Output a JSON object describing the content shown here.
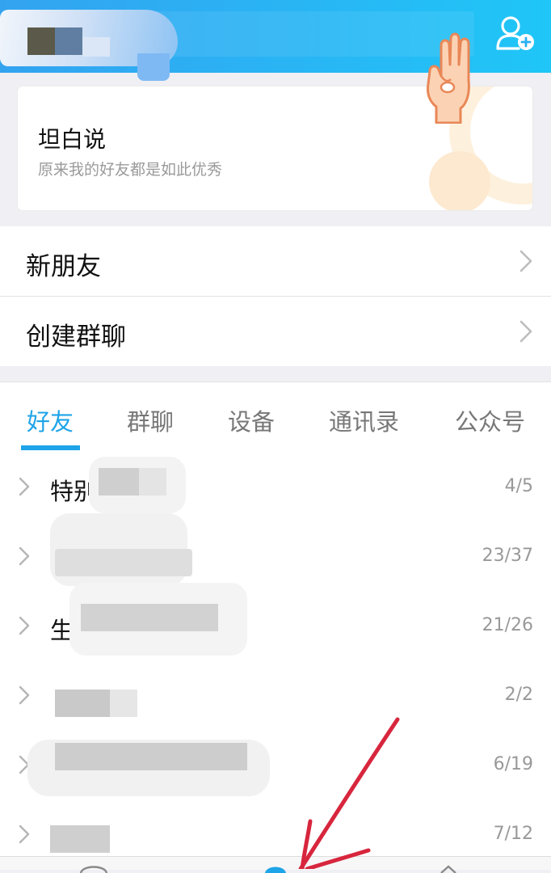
{
  "header": {
    "bg_color": "#2aaef3",
    "icons": [
      "user-avatar-blurred",
      "add-contact-icon"
    ]
  },
  "card": {
    "title": "坦白说",
    "subtitle": "原来我的好友都是如此优秀",
    "icon": "hand-three-fingers"
  },
  "menu": {
    "items": [
      {
        "label": "新朋友"
      },
      {
        "label": "创建群聊"
      }
    ]
  },
  "tabs": {
    "items": [
      "好友",
      "群聊",
      "设备",
      "通讯录",
      "公众号"
    ],
    "active_index": 0,
    "accent_color": "#1ea4e8"
  },
  "groups": [
    {
      "name": "特别",
      "count": "4/5"
    },
    {
      "name": "",
      "count": "23/37"
    },
    {
      "name": "生",
      "count": "21/26"
    },
    {
      "name": "",
      "count": "2/2"
    },
    {
      "name": "",
      "count": "6/19"
    },
    {
      "name": "",
      "count": "7/12"
    }
  ],
  "annotation": {
    "color": "#d7263d",
    "type": "red-arrow"
  }
}
